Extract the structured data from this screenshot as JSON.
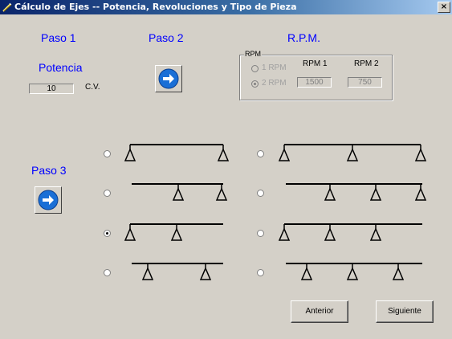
{
  "window": {
    "title": "Cálculo de Ejes -- Potencia, Revoluciones y Tipo de Pieza",
    "close_glyph": "×"
  },
  "step1": {
    "label": "Paso 1",
    "heading": "Potencia",
    "power_value": "10",
    "power_unit": "C.V."
  },
  "step2": {
    "label": "Paso 2",
    "button_icon": "right-arrow-icon"
  },
  "rpm": {
    "heading": "R.P.M.",
    "group_label": "RPM",
    "option_1": "1 RPM",
    "option_2": "2 RPM",
    "selected_option": "2 RPM",
    "col_1_label": "RPM 1",
    "col_2_label": "RPM 2",
    "rpm1_value": "1500",
    "rpm2_value": "750"
  },
  "step3": {
    "label": "Paso 3",
    "button_icon": "right-arrow-icon"
  },
  "beam_options": {
    "selected": "left-3",
    "items": [
      {
        "id": "left-1",
        "supports": 2
      },
      {
        "id": "left-2",
        "supports": 2
      },
      {
        "id": "left-3",
        "supports": 2
      },
      {
        "id": "left-4",
        "supports": 2
      },
      {
        "id": "right-1",
        "supports": 3
      },
      {
        "id": "right-2",
        "supports": 3
      },
      {
        "id": "right-3",
        "supports": 3
      },
      {
        "id": "right-4",
        "supports": 3
      }
    ]
  },
  "buttons": {
    "back_label": "Anterior",
    "next_label": "Siguiente"
  },
  "colors": {
    "title_bar_start": "#0a246a",
    "title_bar_end": "#a6caf0",
    "heading_blue": "#0000ff",
    "face": "#d4d0c8",
    "arrow_circle": "#1a6fd6"
  }
}
